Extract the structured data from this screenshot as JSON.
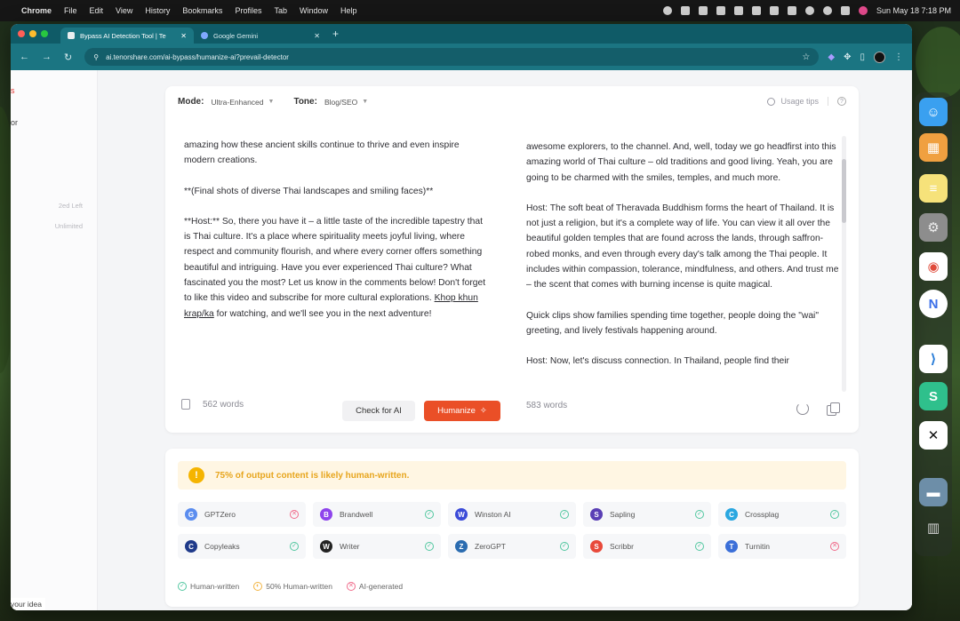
{
  "menubar": {
    "app": "Chrome",
    "items": [
      "File",
      "Edit",
      "View",
      "History",
      "Bookmarks",
      "Profiles",
      "Tab",
      "Window",
      "Help"
    ],
    "clock": "Sun May 18  7:18 PM"
  },
  "browser": {
    "tabs": [
      {
        "label": "Bypass AI Detection Tool | Te",
        "active": true
      },
      {
        "label": "Google Gemini",
        "active": false
      }
    ],
    "url": "ai.tenorshare.com/ai-bypass/humanize-ai?prevail-detector"
  },
  "sidebar": {
    "fragment_top": "s",
    "fragment_mid": "or",
    "dim_1": "2ed Left",
    "dim_2": "Unlimited",
    "bottom_text": "your idea"
  },
  "options": {
    "mode_label": "Mode:",
    "mode_value": "Ultra-Enhanced",
    "tone_label": "Tone:",
    "tone_value": "Blog/SEO",
    "usage_tips": "Usage tips"
  },
  "input": {
    "paragraphs": [
      "amazing how these ancient skills continue to thrive and even inspire modern creations.",
      "**(Final shots of diverse Thai landscapes and smiling faces)**"
    ],
    "host_before": "**Host:** So, there you have it – a little taste of the incredible tapestry that is Thai culture. It's a place where spirituality meets joyful living, where respect and community flourish, and where every corner offers something beautiful and intriguing. Have you ever experienced Thai culture? What fascinated you the most? Let us know in the comments below! Don't forget to like this video and subscribe for more cultural explorations. ",
    "host_link": "Khop khun krap/ka",
    "host_after": " for watching, and we'll see you in the next adventure!",
    "word_count": "562 words"
  },
  "buttons": {
    "check": "Check for AI",
    "humanize": "Humanize"
  },
  "output": {
    "paragraphs": [
      "awesome explorers, to the channel. And, well, today we go headfirst into this amazing world of Thai culture – old traditions and good living. Yeah, you are going to be charmed with the smiles, temples, and much more.",
      "Host: The soft beat of Theravada Buddhism forms the heart of Thailand. It is not just a religion, but it's a complete way of life. You can view it all over the beautiful golden temples that are found across the lands, through saffron-robed monks, and even through every day's talk among the Thai people. It includes within compassion, tolerance, mindfulness, and others. And trust me – the scent that comes with burning incense is quite magical.",
      "Quick clips show families spending time together, people doing the \"wai\" greeting, and lively festivals happening around.",
      "Host: Now, let's discuss connection. In Thailand, people find their"
    ],
    "word_count": "583 words"
  },
  "result": {
    "banner": "75% of output content is likely human-written.",
    "detectors": [
      {
        "name": "GPTZero",
        "icon": "gptzero-icon",
        "color": "#5b8def",
        "status": "ai"
      },
      {
        "name": "Brandwell",
        "icon": "brandwell-icon",
        "color": "#8e44ec",
        "status": "ok"
      },
      {
        "name": "Winston AI",
        "icon": "winston-icon",
        "color": "#3b4bd8",
        "status": "ok"
      },
      {
        "name": "Sapling",
        "icon": "sapling-icon",
        "color": "#5a3fb5",
        "status": "ok"
      },
      {
        "name": "Crossplag",
        "icon": "crossplag-icon",
        "color": "#2aa7e0",
        "status": "ok"
      },
      {
        "name": "Copyleaks",
        "icon": "copyleaks-icon",
        "color": "#1f3a8a",
        "status": "ok"
      },
      {
        "name": "Writer",
        "icon": "writer-icon",
        "color": "#222222",
        "status": "ok"
      },
      {
        "name": "ZeroGPT",
        "icon": "zerogpt-icon",
        "color": "#2b6cb0",
        "status": "ok"
      },
      {
        "name": "Scribbr",
        "icon": "scribbr-icon",
        "color": "#e8493a",
        "status": "ok"
      },
      {
        "name": "Turnitin",
        "icon": "turnitin-icon",
        "color": "#3b6fd8",
        "status": "ai"
      }
    ],
    "legend": {
      "human": "Human-written",
      "half": "50% Human-written",
      "ai": "AI-generated"
    }
  }
}
